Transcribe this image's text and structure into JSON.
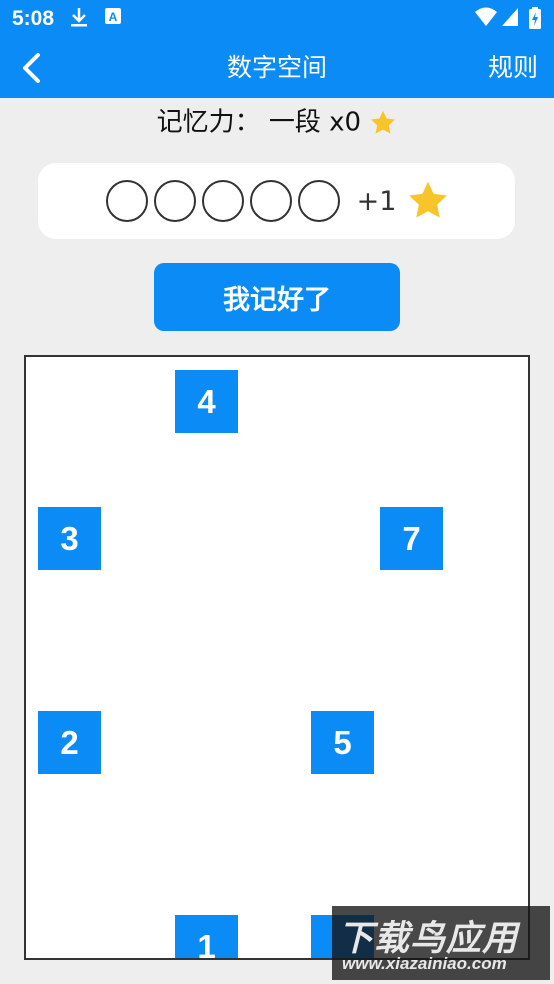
{
  "status_bar": {
    "time": "5:08"
  },
  "app_bar": {
    "title": "数字空间",
    "rules_label": "规则"
  },
  "level": {
    "label": "记忆力：",
    "rank": "一段 x0"
  },
  "answer": {
    "bonus": "+1"
  },
  "confirm_button": "我记好了",
  "tiles": [
    {
      "value": "4"
    },
    {
      "value": "3"
    },
    {
      "value": "7"
    },
    {
      "value": "2"
    },
    {
      "value": "5"
    },
    {
      "value": "1"
    },
    {
      "value": ""
    }
  ],
  "watermark": {
    "title": "下载鸟应用",
    "subtitle": "www.xiazainiao.com"
  },
  "colors": {
    "accent": "#0a8bf6",
    "star": "#f7c52a"
  }
}
